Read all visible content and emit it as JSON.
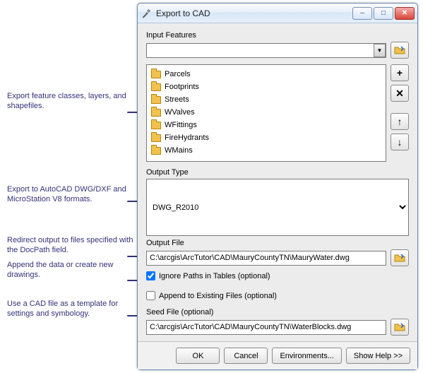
{
  "window": {
    "title": "Export to CAD",
    "minimize": "–",
    "maximize": "□",
    "close": "✕"
  },
  "labels": {
    "input_features": "Input Features",
    "output_type": "Output Type",
    "output_file": "Output File",
    "seed_file": "Seed File (optional)"
  },
  "input_combo": "",
  "features": [
    "Parcels",
    "Footprints",
    "Streets",
    "WValves",
    "WFittings",
    "FireHydrants",
    "WMains"
  ],
  "output_type": "DWG_R2010",
  "output_file": "C:\\arcgis\\ArcTutor\\CAD\\MauryCountyTN\\MauryWater.dwg",
  "seed_file": "C:\\arcgis\\ArcTutor\\CAD\\MauryCountyTN\\WaterBlocks.dwg",
  "checks": {
    "ignore_paths": {
      "label": "Ignore Paths in Tables (optional)",
      "checked": true
    },
    "append": {
      "label": "Append to Existing Files (optional)",
      "checked": false
    }
  },
  "buttons": {
    "ok": "OK",
    "cancel": "Cancel",
    "environments": "Environments...",
    "showhelp": "Show Help >>"
  },
  "annotations": {
    "a1": "Export feature classes, layers, and shapefiles.",
    "a2": "Export to AutoCAD DWG/DXF and MicroStation V8 formats.",
    "a3": "Redirect output to files specified with the DocPath field.",
    "a4": "Append the data or create new drawings.",
    "a5": "Use a CAD file as a template for settings and symbology."
  },
  "sidebtn_glyphs": {
    "add": "+",
    "remove": "✕",
    "up": "↑",
    "down": "↓"
  }
}
